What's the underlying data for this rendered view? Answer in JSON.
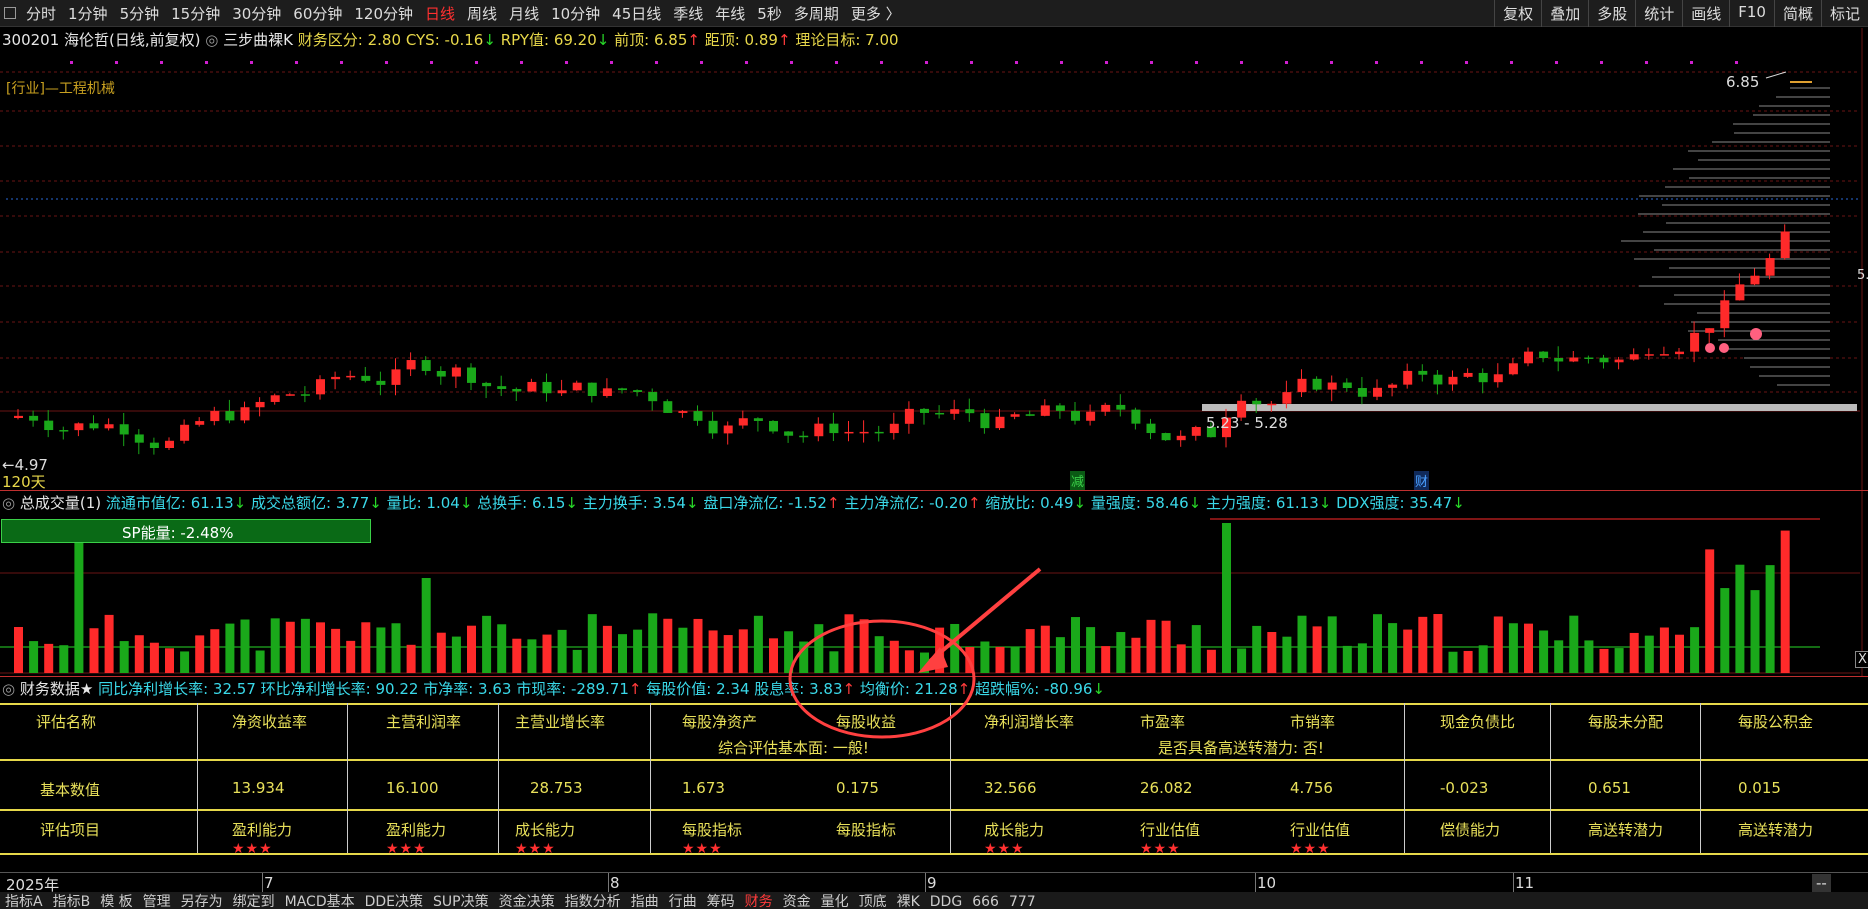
{
  "toolbar": {
    "periods": [
      "分时",
      "1分钟",
      "5分钟",
      "15分钟",
      "30分钟",
      "60分钟",
      "120分钟",
      "日线",
      "周线",
      "月线",
      "10分钟",
      "45日线",
      "季线",
      "年线",
      "5秒",
      "多周期",
      "更多 〉"
    ],
    "active_period": "日线",
    "right_tools": [
      "复权",
      "叠加",
      "多股",
      "统计",
      "画线",
      "F10",
      "简概",
      "标记"
    ]
  },
  "main": {
    "stock": "300201 海伦哲(日线,前复权)",
    "indicator": "三步曲裸K",
    "finance_label": "财务区分: 2.80",
    "cys": "CYS: -0.16",
    "rpy": "RPY值: 69.20",
    "prev_top": "前顶: 6.85",
    "distance": "距顶: 0.89",
    "target": "理论目标: 7.00",
    "industry": "[行业]—工程机械",
    "high_label": "6.85",
    "low_label": "4.97",
    "range_label": "5.23 - 5.28",
    "days_label": "120天",
    "marker_jian": "减",
    "marker_cai": "财",
    "right_edge_label": "5."
  },
  "volume": {
    "title": "总成交量(1)",
    "items": [
      {
        "text": "流通市值亿: 61.13",
        "dir": "↓"
      },
      {
        "text": "成交总额亿: 3.77",
        "dir": "↓"
      },
      {
        "text": "量比: 1.04",
        "dir": "↓"
      },
      {
        "text": "总换手: 6.15",
        "dir": "↓"
      },
      {
        "text": "主力换手: 3.54",
        "dir": "↓"
      },
      {
        "text": "盘口净流亿: -1.52",
        "dir": "↑"
      },
      {
        "text": "主力净流亿: -0.20",
        "dir": "↑"
      },
      {
        "text": "缩放比: 0.49",
        "dir": "↓"
      },
      {
        "text": "量强度: 58.46",
        "dir": "↓"
      },
      {
        "text": "主力强度: 61.13",
        "dir": "↓"
      },
      {
        "text": "DDX强度: 35.47",
        "dir": "↓"
      }
    ],
    "sp_energy": "SP能量:   -2.48%",
    "close_label": "X"
  },
  "finance": {
    "title": "财务数据★",
    "items": [
      {
        "text": "同比净利增长率: 32.57",
        "dir": ""
      },
      {
        "text": "环比净利增长率: 90.22",
        "dir": ""
      },
      {
        "text": "市净率: 3.63",
        "dir": ""
      },
      {
        "text": "市现率: -289.71",
        "dir": "↑"
      },
      {
        "text": "每股价值: 2.34",
        "dir": ""
      },
      {
        "text": "股息率: 3.83",
        "dir": "↑"
      },
      {
        "text": "均衡价: 21.28",
        "dir": "↑"
      },
      {
        "text": "超跌幅%: -80.96",
        "dir": "↓"
      }
    ],
    "headers": [
      "评估名称",
      "净资收益率",
      "主营利润率",
      "主营业增长率",
      "每股净资产",
      "每股收益",
      "净利润增长率",
      "市盈率",
      "市销率",
      "现金负债比",
      "每股未分配",
      "每股公积金"
    ],
    "summary1": "综合评估基本面: 一般!",
    "summary2": "是否具备高送转潜力: 否!",
    "values": [
      "基本数值",
      "13.934",
      "16.100",
      "28.753",
      "1.673",
      "0.175",
      "32.566",
      "26.082",
      "4.756",
      "-0.023",
      "0.651",
      "0.015"
    ],
    "items_row": [
      "评估项目",
      "盈利能力",
      "盈利能力",
      "成长能力",
      "每股指标",
      "每股指标",
      "成长能力",
      "行业估值",
      "行业估值",
      "偿债能力",
      "高送转潜力",
      "高送转潜力"
    ],
    "stars": [
      "",
      "★★★",
      "★★★",
      "★★★",
      "★★★",
      "",
      "★★★",
      "★★★",
      "★★★",
      "",
      "",
      ""
    ]
  },
  "date_axis": {
    "year": "2025年",
    "months": [
      "7",
      "8",
      "9",
      "10",
      "11"
    ],
    "corner": "--"
  },
  "tabs": [
    "指标A",
    "指标B",
    "模 板",
    "管理",
    "另存为",
    "绑定到",
    "MACD基本",
    "DDE决策",
    "SUP决策",
    "资金决策",
    "指数分析",
    "指曲",
    "行曲",
    "筹码",
    "财务",
    "资金",
    "量化",
    "顶底",
    "裸K",
    "DDG",
    "666",
    "777"
  ],
  "active_tab": "财务",
  "colors": {
    "up": "#ff2a2a",
    "down": "#1aa81a",
    "grid": "#7a1a1a",
    "accent": "#e8d84a"
  }
}
